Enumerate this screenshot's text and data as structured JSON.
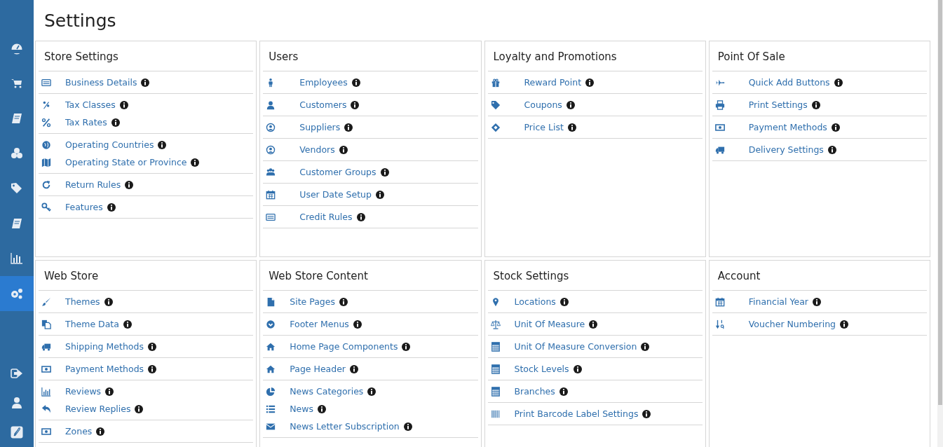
{
  "sidebar": {
    "items": [
      {
        "selected": false
      },
      {
        "selected": false
      },
      {
        "selected": false
      },
      {
        "selected": false
      },
      {
        "selected": false
      },
      {
        "selected": false
      },
      {
        "selected": false
      },
      {
        "selected": true
      }
    ],
    "bottom_items": [
      {
        "selected": false
      },
      {
        "selected": false
      },
      {
        "selected": false
      }
    ]
  },
  "page": {
    "title": "Settings"
  },
  "cards": [
    {
      "title": "Store Settings",
      "groups": [
        [
          "Business Details"
        ],
        [
          "Tax Classes",
          "Tax Rates"
        ],
        [
          "Operating Countries",
          "Operating State or Province"
        ],
        [
          "Return Rules"
        ],
        [
          "Features"
        ]
      ]
    },
    {
      "title": "Users",
      "groups": [
        [
          "Employees"
        ],
        [
          "Customers"
        ],
        [
          "Suppliers"
        ],
        [
          "Vendors"
        ],
        [
          "Customer Groups"
        ],
        [
          "User Date Setup"
        ],
        [
          "Credit Rules"
        ]
      ]
    },
    {
      "title": "Loyalty and Promotions",
      "groups": [
        [
          "Reward Point"
        ],
        [
          "Coupons"
        ],
        [
          "Price List"
        ]
      ]
    },
    {
      "title": "Point Of Sale",
      "groups": [
        [
          "Quick Add Buttons"
        ],
        [
          "Print Settings"
        ],
        [
          "Payment Methods"
        ],
        [
          "Delivery Settings"
        ]
      ]
    },
    {
      "title": "Web Store",
      "groups": [
        [
          "Themes"
        ],
        [
          "Theme Data"
        ],
        [
          "Shipping Methods"
        ],
        [
          "Payment Methods"
        ],
        [
          "Reviews",
          "Review Replies"
        ],
        [
          "Zones"
        ]
      ]
    },
    {
      "title": "Web Store Content",
      "groups": [
        [
          "Site Pages"
        ],
        [
          "Footer Menus"
        ],
        [
          "Home Page Components"
        ],
        [
          "Page Header"
        ],
        [
          "News Categories",
          "News",
          "News Letter Subscription"
        ]
      ]
    },
    {
      "title": "Stock Settings",
      "groups": [
        [
          "Locations"
        ],
        [
          "Unit Of Measure"
        ],
        [
          "Unit Of Measure Conversion"
        ],
        [
          "Stock Levels"
        ],
        [
          "Branches"
        ],
        [
          "Print Barcode Label Settings"
        ]
      ]
    },
    {
      "title": "Account",
      "groups": [
        [
          "Financial Year"
        ],
        [
          "Voucher Numbering"
        ]
      ]
    }
  ]
}
